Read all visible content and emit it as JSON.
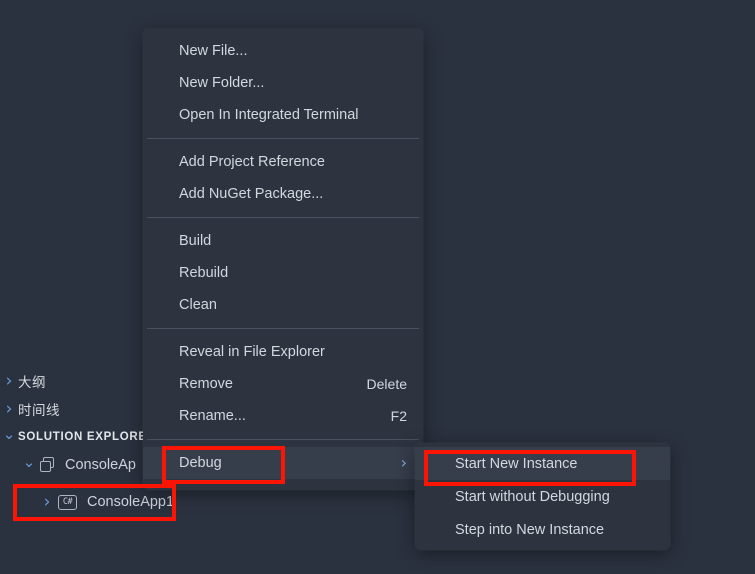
{
  "window": {
    "background_color": "#2b323f",
    "menu_background_color": "#2d3440",
    "hover_color": "#363d4b",
    "text_color": "#d3d7de",
    "accent_color": "#7aa8e0",
    "annotation_color": "#fc1404"
  },
  "sidebar": {
    "panels": [
      {
        "label": "大纲",
        "state": "collapsed",
        "icon": "chevron-right-icon"
      },
      {
        "label": "时间线",
        "state": "collapsed",
        "icon": "chevron-right-icon"
      },
      {
        "label": "SOLUTION EXPLORER",
        "state": "expanded",
        "icon": "chevron-down-icon"
      }
    ],
    "tree": [
      {
        "label": "ConsoleAp",
        "state": "expanded",
        "icon": "solution-icon",
        "indent": 0
      },
      {
        "label": "ConsoleApp1",
        "state": "collapsed",
        "icon": "csharp-icon",
        "indent": 1
      }
    ],
    "csharp_icon_text": "C#"
  },
  "context_menu": {
    "name": "project-context-menu",
    "groups": [
      {
        "items": [
          {
            "label": "New File...",
            "shortcut": ""
          },
          {
            "label": "New Folder...",
            "shortcut": ""
          },
          {
            "label": "Open In Integrated Terminal",
            "shortcut": ""
          }
        ]
      },
      {
        "items": [
          {
            "label": "Add Project Reference",
            "shortcut": ""
          },
          {
            "label": "Add NuGet Package...",
            "shortcut": ""
          }
        ]
      },
      {
        "items": [
          {
            "label": "Build",
            "shortcut": ""
          },
          {
            "label": "Rebuild",
            "shortcut": ""
          },
          {
            "label": "Clean",
            "shortcut": ""
          }
        ]
      },
      {
        "items": [
          {
            "label": "Reveal in File Explorer",
            "shortcut": ""
          },
          {
            "label": "Remove",
            "shortcut": "Delete"
          },
          {
            "label": "Rename...",
            "shortcut": "F2"
          }
        ]
      },
      {
        "items": [
          {
            "label": "Debug",
            "shortcut": "",
            "hovered": true,
            "has_submenu": true,
            "submenu_arrow": "›"
          }
        ]
      }
    ]
  },
  "submenu": {
    "name": "debug-submenu",
    "items": [
      {
        "label": "Start New Instance",
        "highlighted": true
      },
      {
        "label": "Start without Debugging",
        "highlighted": false
      },
      {
        "label": "Step into New Instance",
        "highlighted": false
      }
    ]
  },
  "annotations": [
    {
      "name": "annotation-debug",
      "target": "Debug"
    },
    {
      "name": "annotation-start-new",
      "target": "Start New Instance"
    },
    {
      "name": "annotation-consoleapp1",
      "target": "ConsoleApp1"
    }
  ]
}
